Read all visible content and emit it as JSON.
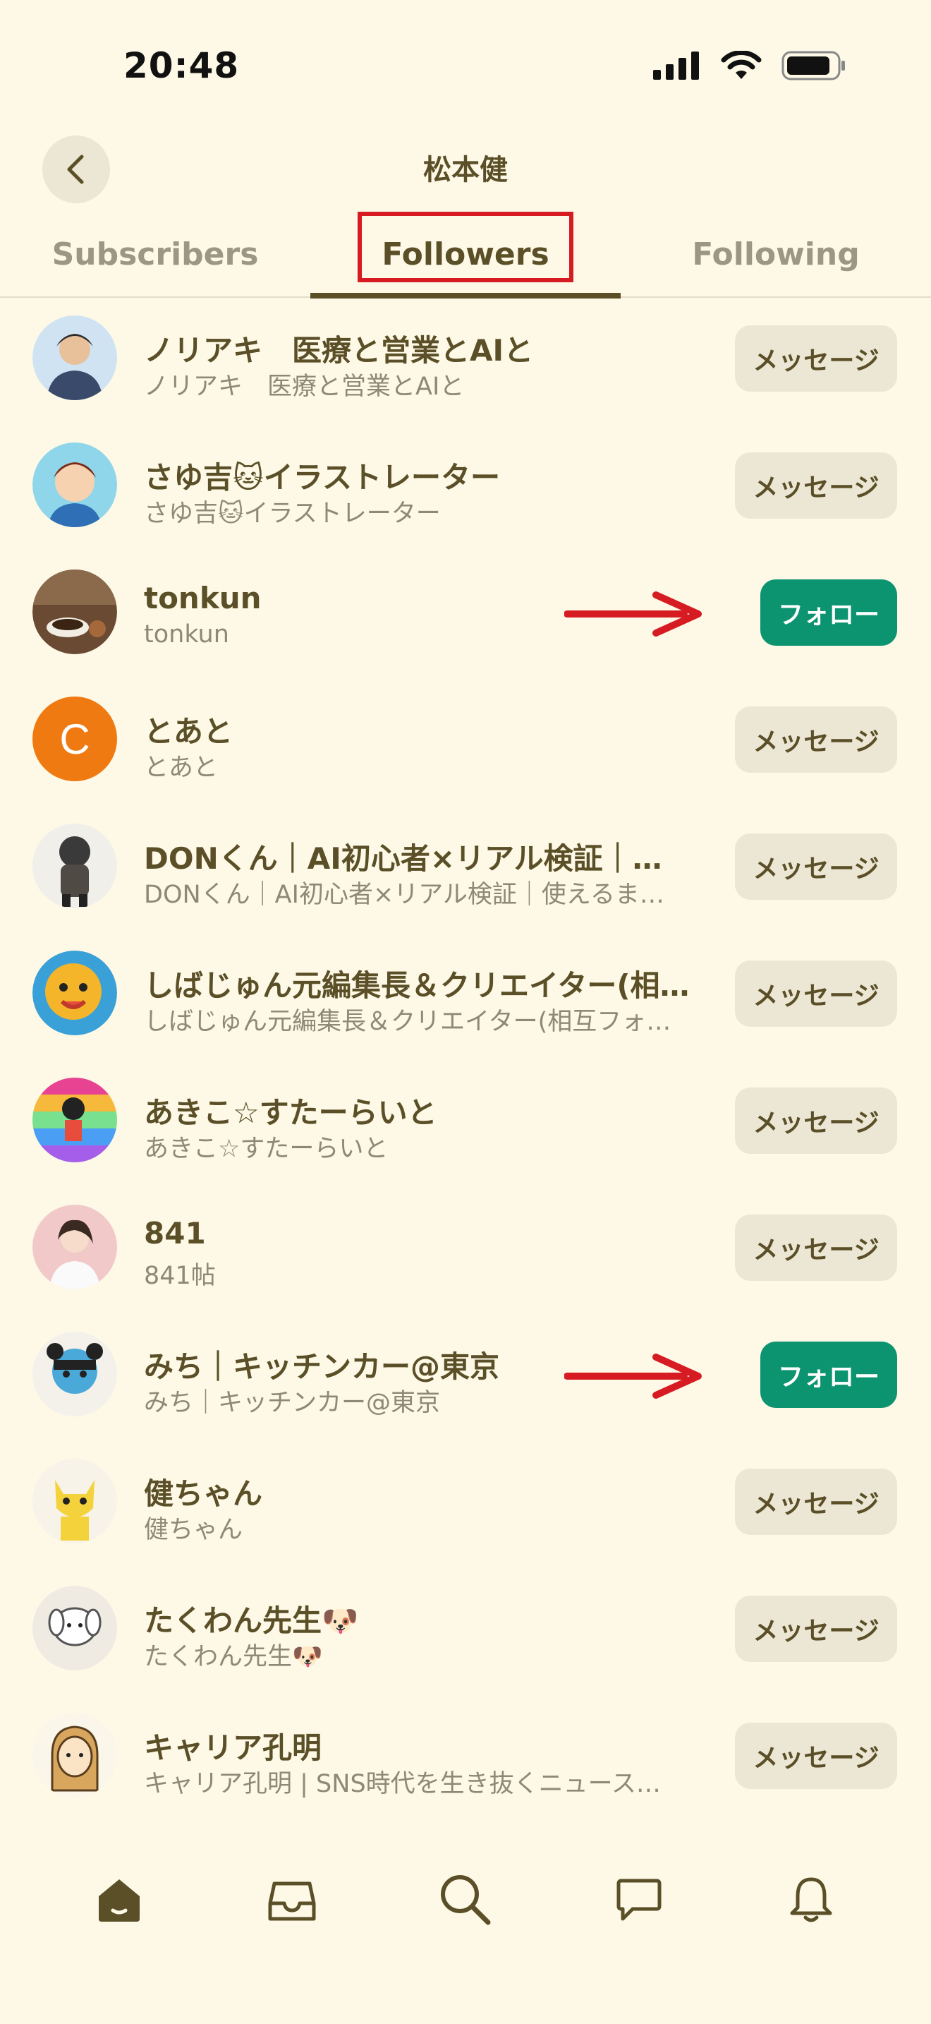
{
  "status_bar": {
    "time": "20:48"
  },
  "header": {
    "title": "松本健"
  },
  "tabs": [
    {
      "label": "Subscribers",
      "active": false
    },
    {
      "label": "Followers",
      "active": true
    },
    {
      "label": "Following",
      "active": false
    }
  ],
  "followers": [
    {
      "name": "ノリアキ　医療と営業とAIと",
      "sub": "ノリアキ　医療と営業とAIと",
      "button": "メッセージ",
      "type": "message",
      "avatar_color": "#8fb7de"
    },
    {
      "name": "さゆ吉🐱イラストレーター",
      "sub": "さゆ吉🐱イラストレーター",
      "button": "メッセージ",
      "type": "message",
      "avatar_color": "#7fd0e8"
    },
    {
      "name": "tonkun",
      "sub": "tonkun",
      "button": "フォロー",
      "type": "follow",
      "avatar_color": "#6b4a33"
    },
    {
      "name": "とあと",
      "sub": "とあと",
      "button": "メッセージ",
      "type": "message",
      "avatar_color": "#f07a12",
      "avatar_letter": "C"
    },
    {
      "name": "DONくん｜AI初心者×リアル検証｜…",
      "sub": "DONくん｜AI初心者×リアル検証｜使えるま…",
      "button": "メッセージ",
      "type": "message",
      "avatar_color": "#4a4a4a"
    },
    {
      "name": "しばじゅん元編集長＆クリエイター(相…",
      "sub": "しばじゅん元編集長＆クリエイター(相互フォ…",
      "button": "メッセージ",
      "type": "message",
      "avatar_color": "#f5b52a"
    },
    {
      "name": "あきこ☆すたーらいと",
      "sub": "あきこ☆すたーらいと",
      "button": "メッセージ",
      "type": "message",
      "avatar_color": "#e86aa8"
    },
    {
      "name": "841",
      "sub": "841帖",
      "button": "メッセージ",
      "type": "message",
      "avatar_color": "#f1c9c9"
    },
    {
      "name": "みち｜キッチンカー@東京",
      "sub": "みち｜キッチンカー@東京",
      "button": "フォロー",
      "type": "follow",
      "avatar_color": "#4aa9d8"
    },
    {
      "name": "健ちゃん",
      "sub": "健ちゃん",
      "button": "メッセージ",
      "type": "message",
      "avatar_color": "#f4d23c"
    },
    {
      "name": "たくわん先生🐶",
      "sub": "たくわん先生🐶",
      "button": "メッセージ",
      "type": "message",
      "avatar_color": "#efebe3"
    },
    {
      "name": "キャリア孔明",
      "sub": "キャリア孔明 | SNS時代を生き抜くニュース…",
      "button": "メッセージ",
      "type": "message",
      "avatar_color": "#f3e1b8"
    }
  ],
  "colors": {
    "accent_follow": "#0c9370",
    "annotation_red": "#d61b22",
    "background": "#fdf9e6"
  },
  "bottom_nav": [
    {
      "icon": "home-icon",
      "active": true
    },
    {
      "icon": "inbox-icon",
      "active": false
    },
    {
      "icon": "search-icon",
      "active": false
    },
    {
      "icon": "chat-bubble-icon",
      "active": false
    },
    {
      "icon": "bell-icon",
      "active": false
    }
  ]
}
